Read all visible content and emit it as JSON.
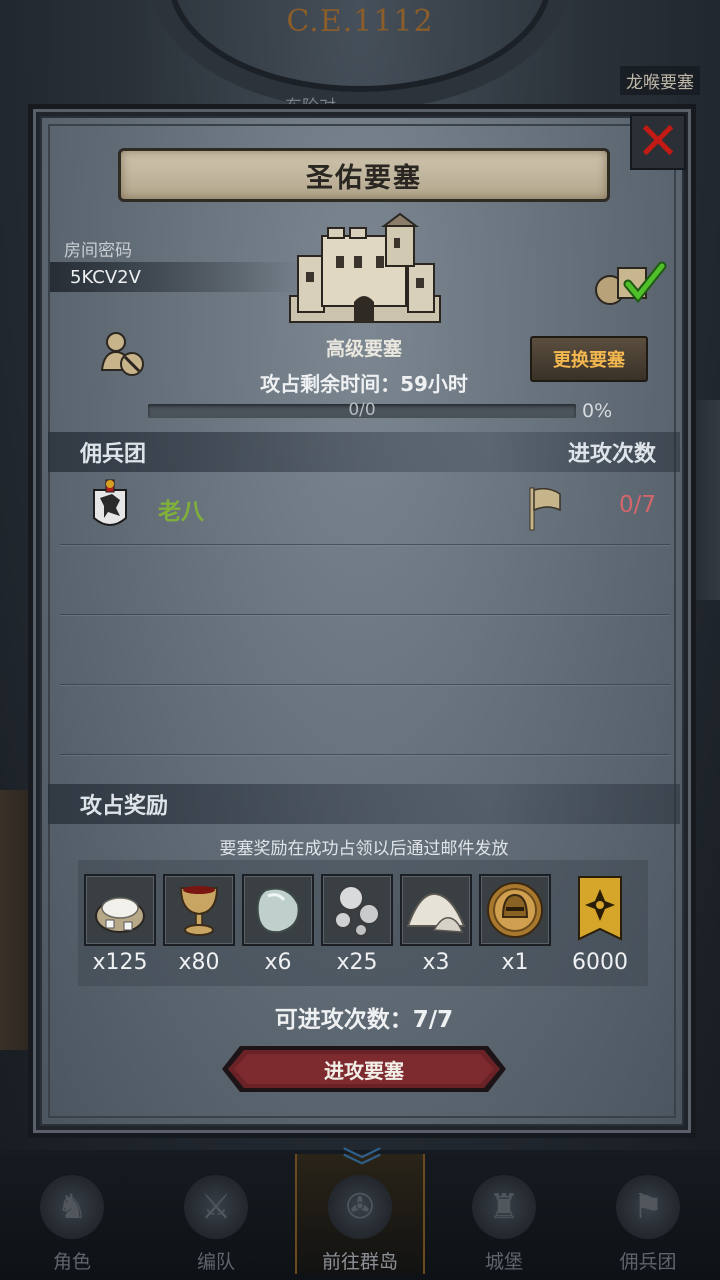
{
  "background": {
    "era": "C.E.1112",
    "map_label": "龙喉要塞",
    "map_label_partial": "东阶对"
  },
  "panel": {
    "title": "圣佑要塞",
    "close_icon": "close-x-icon",
    "room_code_label": "房间密码",
    "room_code": "5KCV2V",
    "fortress_level": "高级要塞",
    "change_button": "更换要塞",
    "time_remaining": "攻占剩余时间：59小时",
    "progress_text": "0/0",
    "progress_percent": "0%",
    "progress_value": 0
  },
  "mercenary_section": {
    "title": "佣兵团",
    "attacks_header": "进攻次数",
    "rows": [
      {
        "name": "老八",
        "attacks": "0/7",
        "emblem_icon": "wolf-shield-icon",
        "flag_icon": "flag-icon"
      }
    ]
  },
  "reward_section": {
    "title": "攻占奖励",
    "note": "要塞奖励在成功占领以后通过邮件发放",
    "items": [
      {
        "icon": "salt-sack-icon",
        "count": "x125"
      },
      {
        "icon": "goblet-icon",
        "count": "x80"
      },
      {
        "icon": "gem-stone-icon",
        "count": "x6"
      },
      {
        "icon": "silver-ore-icon",
        "count": "x25"
      },
      {
        "icon": "powder-pile-icon",
        "count": "x3"
      },
      {
        "icon": "gold-helmet-coin-icon",
        "count": "x1"
      },
      {
        "icon": "honor-banner-icon",
        "count": "6000"
      }
    ]
  },
  "attempts_text": "可进攻次数：7/7",
  "attack_button": "进攻要塞",
  "bottom_nav": [
    {
      "label": "角色",
      "icon": "character-icon"
    },
    {
      "label": "编队",
      "icon": "formation-icon"
    },
    {
      "label": "前往群岛",
      "icon": "islands-icon"
    },
    {
      "label": "城堡",
      "icon": "castle-icon"
    },
    {
      "label": "佣兵团",
      "icon": "mercenary-icon"
    }
  ],
  "colors": {
    "close_red": "#c21a14",
    "change_button_text": "#f3b750",
    "merc_name_green": "#7fb03a",
    "attacks_red": "#d3666b",
    "attack_button": "#6a2226"
  }
}
